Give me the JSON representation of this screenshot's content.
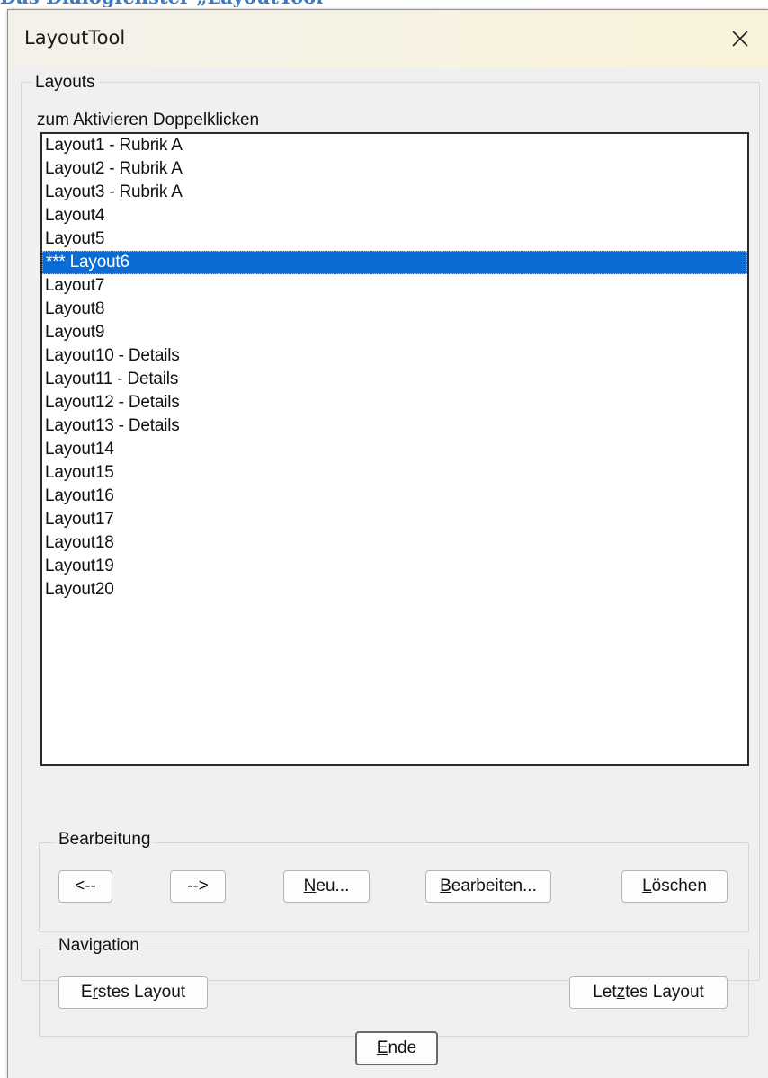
{
  "doc_heading": "Das Dialogfenster „LayoutTool“",
  "window": {
    "title": "LayoutTool",
    "close_icon": "close-icon"
  },
  "layouts_group": {
    "label": "Layouts",
    "hint": "zum Aktivieren Doppelklicken",
    "items": [
      "Layout1 - Rubrik A",
      "Layout2 - Rubrik A",
      "Layout3 - Rubrik A",
      "Layout4",
      "Layout5",
      "*** Layout6",
      "Layout7",
      "Layout8",
      "Layout9",
      "Layout10 - Details",
      "Layout11 - Details",
      "Layout12 - Details",
      "Layout13 - Details",
      "Layout14",
      "Layout15",
      "Layout16",
      "Layout17",
      "Layout18",
      "Layout19",
      "Layout20"
    ],
    "selected_index": 5
  },
  "bearbeitung_group": {
    "label": "Bearbeitung",
    "buttons": {
      "back": "<--",
      "forward": "-->",
      "new": {
        "u": "N",
        "rest": "eu..."
      },
      "edit": {
        "u": "B",
        "rest": "earbeiten..."
      },
      "delete": {
        "u": "L",
        "rest": "öschen"
      }
    }
  },
  "navigation_group": {
    "label": "Navigation",
    "buttons": {
      "first": {
        "pre": "E",
        "u": "r",
        "rest": "stes Layout"
      },
      "last": {
        "pre": "Let",
        "u": "z",
        "rest": "tes Layout"
      }
    }
  },
  "footer": {
    "end": {
      "u": "E",
      "rest": "nde"
    }
  },
  "colors": {
    "selection": "#0a6bd4",
    "heading": "#3b7bbf"
  }
}
